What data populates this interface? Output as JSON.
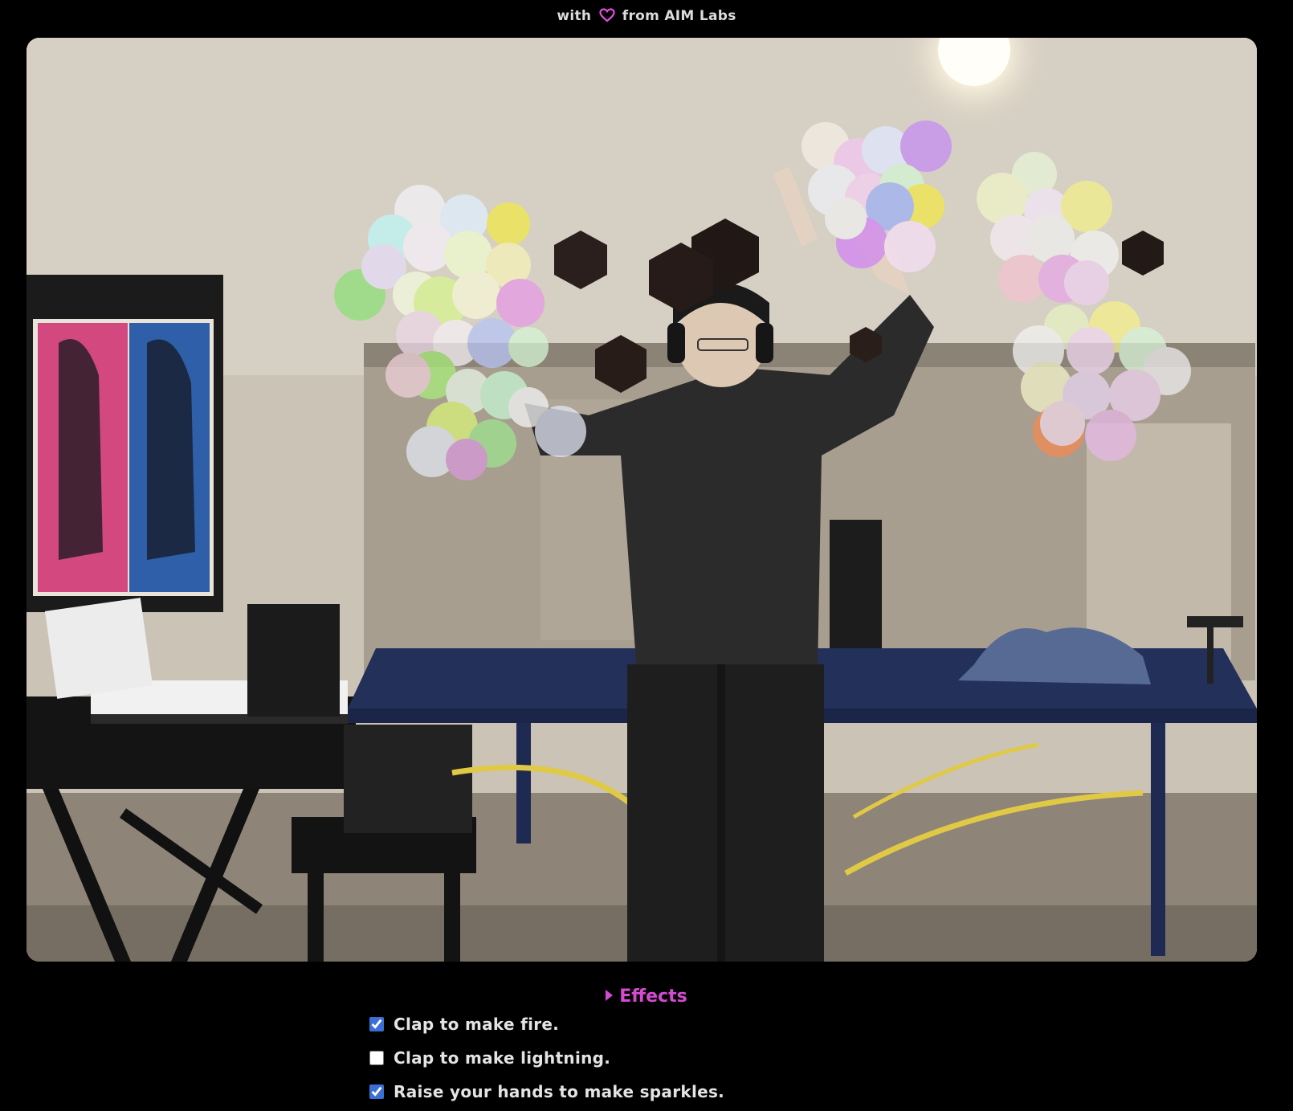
{
  "credit": {
    "prefix": "with",
    "icon": "heart-icon",
    "icon_color": "#e64ce0",
    "suffix": "from AIM Labs"
  },
  "video": {
    "description_icon": "webcam-feed"
  },
  "effects": {
    "summary": "Effects",
    "accent": "#d44ad0",
    "options": [
      {
        "label": "Clap to make fire.",
        "checked": true
      },
      {
        "label": "Clap to make lightning.",
        "checked": false
      },
      {
        "label": "Raise your hands to make sparkles.",
        "checked": true
      }
    ]
  }
}
